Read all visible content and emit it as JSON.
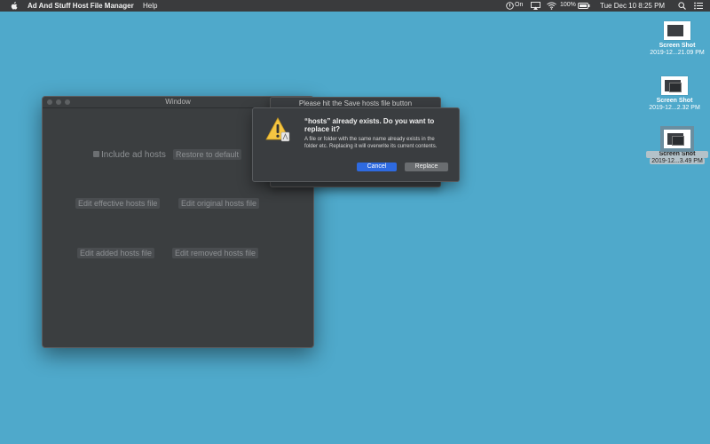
{
  "menubar": {
    "app_name": "Ad And Stuff Host File Manager",
    "help": "Help",
    "vpn_label": "On",
    "battery_percent": "100%",
    "clock": "Tue Dec 10  8:25 PM"
  },
  "desktop": {
    "icons": [
      {
        "name": "Screen Shot",
        "date": "2019-12...21.09 PM"
      },
      {
        "name": "Screen Shot",
        "date": "2019-12...2.32 PM"
      },
      {
        "name": "Screen Shot",
        "date": "2019-12...3.49 PM"
      }
    ]
  },
  "window": {
    "title": "Window",
    "include_ad_hosts": "Include ad hosts",
    "restore_default": "Restore to default",
    "edit_effective": "Edit effective hosts file",
    "edit_original": "Edit original hosts file",
    "edit_added": "Edit added hosts file",
    "edit_removed": "Edit removed hosts file"
  },
  "sheet": {
    "title": "Please hit the Save hosts file button"
  },
  "alert": {
    "message": "“hosts” already exists. Do you want to replace it?",
    "informative": "A file or folder with the same name already exists in the folder etc. Replacing it will overwrite its current contents.",
    "cancel": "Cancel",
    "replace": "Replace"
  },
  "colors": {
    "desktop": "#4fa9cb",
    "menubar": "#3a3b3d",
    "window": "#3b3e40",
    "accent": "#2e6ae0"
  }
}
